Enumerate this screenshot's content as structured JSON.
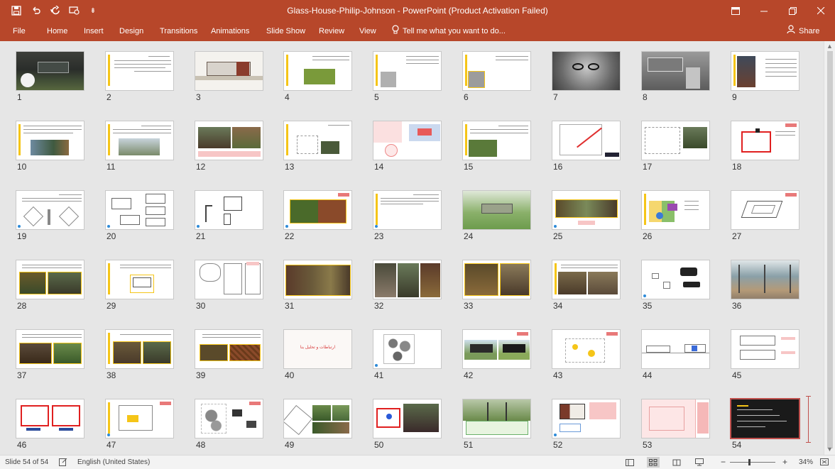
{
  "window": {
    "title": "Glass-House-Philip-Johnson - PowerPoint (Product Activation Failed)",
    "colors": {
      "ribbon": "#b7472a",
      "accent_yellow": "#f5c518",
      "selection": "#c0504d"
    }
  },
  "quick_access": [
    {
      "icon": "save-icon"
    },
    {
      "icon": "undo-icon"
    },
    {
      "icon": "redo-icon"
    },
    {
      "icon": "present-icon"
    },
    {
      "icon": "customize-icon"
    }
  ],
  "ribbon": {
    "tabs": [
      "File",
      "Home",
      "Insert",
      "Design",
      "Transitions",
      "Animations",
      "Slide Show",
      "Review",
      "View"
    ],
    "tell_me": "Tell me what you want to do...",
    "share": "Share"
  },
  "slides": {
    "numbers": [
      "1",
      "2",
      "3",
      "4",
      "5",
      "6",
      "7",
      "8",
      "9",
      "10",
      "11",
      "12",
      "13",
      "14",
      "15",
      "16",
      "17",
      "18",
      "19",
      "20",
      "21",
      "22",
      "23",
      "24",
      "25",
      "26",
      "27",
      "28",
      "29",
      "30",
      "31",
      "32",
      "33",
      "34",
      "35",
      "36",
      "37",
      "38",
      "39",
      "40",
      "41",
      "42",
      "43",
      "44",
      "45",
      "46",
      "47",
      "48",
      "49",
      "50",
      "51",
      "52",
      "53",
      "54"
    ],
    "selected": "54",
    "slide40_title": "ارتباطات و تحلیل بنا"
  },
  "statusbar": {
    "slide_info": "Slide 54 of 54",
    "language": "English (United States)",
    "zoom": "34%",
    "zoom_minus": "−",
    "zoom_plus": "+"
  }
}
